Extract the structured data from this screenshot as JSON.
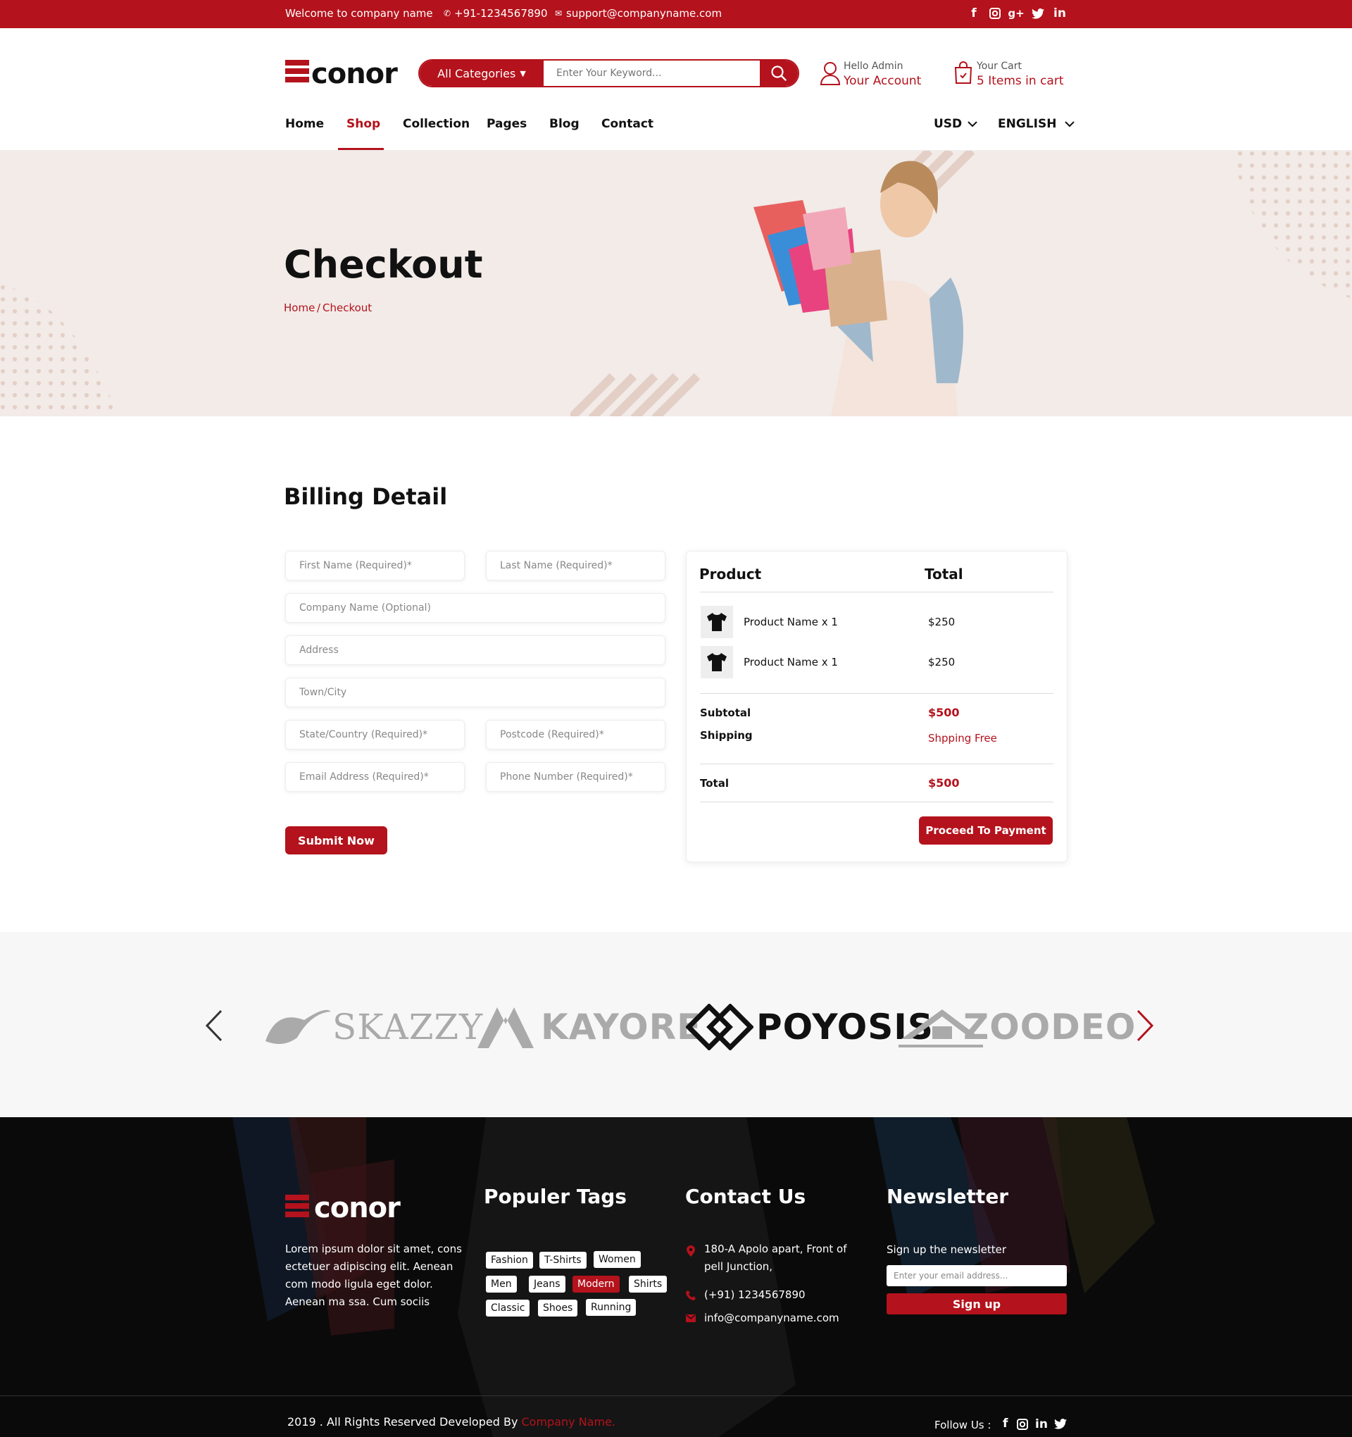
{
  "topbar": {
    "welcome": "Welcome to company name",
    "phone": "+91-1234567890",
    "email": "support@companyname.com",
    "social": [
      "facebook-icon",
      "instagram-icon",
      "google-plus-icon",
      "twitter-icon",
      "linkedin-icon"
    ]
  },
  "header": {
    "logo_text": "conor",
    "search": {
      "category_label": "All Categories",
      "placeholder": "Enter Your Keyword..."
    },
    "account": {
      "greeting": "Hello Admin",
      "label": "Your Account"
    },
    "cart": {
      "label": "Your Cart",
      "count_text": "5 Items in cart"
    },
    "nav": [
      "Home",
      "Shop",
      "Collection",
      "Pages",
      "Blog",
      "Contact"
    ],
    "currency": "USD",
    "language": "ENGLISH"
  },
  "hero": {
    "title": "Checkout",
    "breadcrumb_home": "Home",
    "breadcrumb_sep": "/",
    "breadcrumb_current": "Checkout"
  },
  "billing": {
    "title": "Billing Detail",
    "fields": {
      "first_name": "First Name (Required)*",
      "last_name": "Last Name (Required)*",
      "company": "Company Name (Optional)",
      "address": "Address",
      "town": "Town/City",
      "state": "State/Country (Required)*",
      "postcode": "Postcode (Required)*",
      "email": "Email Address (Required)*",
      "phone": "Phone Number (Required)*"
    },
    "submit_label": "Submit Now"
  },
  "summary": {
    "col_product": "Product",
    "col_total": "Total",
    "items": [
      {
        "name": "Product Name x 1",
        "price": "$250"
      },
      {
        "name": "Product Name x 1",
        "price": "$250"
      }
    ],
    "subtotal_label": "Subtotal",
    "subtotal_value": "$500",
    "shipping_label": "Shipping",
    "shipping_value": "Shpping Free",
    "total_label": "Total",
    "total_value": "$500",
    "pay_label": "Proceed To Payment"
  },
  "brands": [
    "SKAZZY",
    "KAYORE",
    "POYOSIS",
    "ZOODEO"
  ],
  "footer": {
    "logo_text": "conor",
    "about": "Lorem ipsum dolor sit amet, cons ectetuer adipiscing elit. Aenean com modo ligula eget dolor. Aenean ma ssa. Cum sociis",
    "tags_title": "Populer Tags",
    "tags": [
      "Fashion",
      "T-Shirts",
      "Women",
      "Men",
      "Jeans",
      "Modern",
      "Shirts",
      "Classic",
      "Shoes",
      "Running"
    ],
    "contact_title": "Contact Us",
    "address": "180-A Apolo apart, Front of pell Junction,",
    "phone": "(+91) 1234567890",
    "email": "info@companyname.com",
    "newsletter_title": "Newsletter",
    "newsletter_text": "Sign up the newsletter",
    "newsletter_placeholder": "Enter your email address...",
    "signup_label": "Sign up",
    "copyright_text": "2019 . All Rights Reserved Developed By",
    "company_link": "Company Name.",
    "follow_label": "Follow Us :"
  },
  "colors": {
    "accent": "#b4121c",
    "hero_bg": "#f2ebe8",
    "footer_bg": "#0a0a0a"
  }
}
